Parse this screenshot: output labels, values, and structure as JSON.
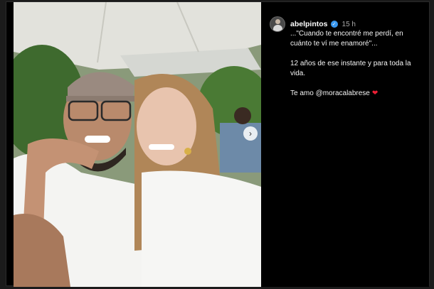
{
  "post": {
    "username": "abelpintos",
    "verified_icon": "verified-badge-icon",
    "time": "15 h",
    "caption": {
      "line1": "...\"Cuando te encontré me perdí, en cuánto te ví me enamoré\"...",
      "line2": "12 años de ese instante y para toda la vida.",
      "line3_prefix": "Te amo ",
      "mention": "@moracalabrese",
      "heart": "❤"
    }
  },
  "photo": {
    "next_glyph": "›"
  },
  "colors": {
    "background": "#000000",
    "text": "#f5f5f5",
    "time": "#a8a8a8",
    "verified": "#3897f0",
    "heart": "#ed1f35"
  }
}
